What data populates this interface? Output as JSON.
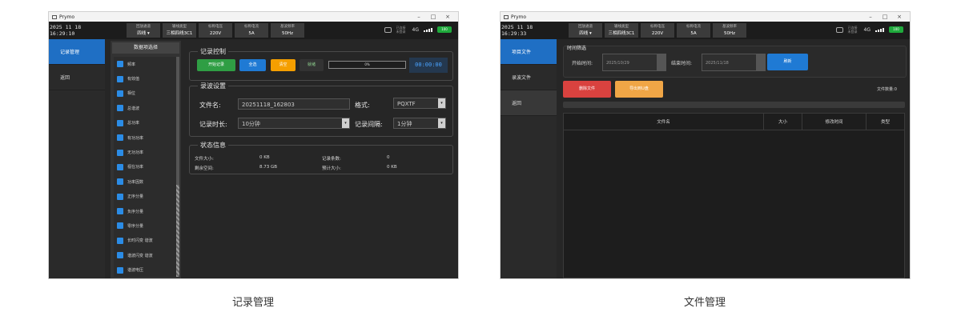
{
  "app_title": "Prymo",
  "window_controls": [
    "–",
    "□",
    "×"
  ],
  "status": {
    "net_label": "已连接 未登录",
    "signal": "4G",
    "battery": "100"
  },
  "header_info": [
    {
      "label": "回放通道",
      "value": "四线 ▾"
    },
    {
      "label": "输线类型",
      "value": "三相四线3C1"
    },
    {
      "label": "标称电压",
      "value": "220V"
    },
    {
      "label": "标称电流",
      "value": "5A"
    },
    {
      "label": "基波频率",
      "value": "50Hz"
    }
  ],
  "left": {
    "clock": "2025 11 18 16:29:10",
    "nav": [
      {
        "label": "记录管理",
        "active": true
      },
      {
        "label": "返回",
        "active": false
      }
    ],
    "channel_panel": {
      "title": "数据项选择",
      "items": [
        "频率",
        "有效值",
        "相位",
        "总谐波",
        "总功率",
        "有功功率",
        "无功功率",
        "视在功率",
        "功率因数",
        "正序分量",
        "负序分量",
        "零序分量",
        "长时闪变 谐波",
        "谐波闪变 谐波",
        "谐波电压"
      ]
    },
    "record_control": {
      "title": "记录控制",
      "start": "开始记录",
      "all": "全选",
      "none": "清空",
      "state": "就绪",
      "progress_text": "0%",
      "progress": 0,
      "timer": "00:00:00"
    },
    "wave_settings": {
      "title": "录波设置",
      "filename_label": "文件名:",
      "filename": "20251118_162803",
      "format_label": "格式:",
      "format": "PQXTF",
      "duration_label": "记录时长:",
      "duration": "10分钟",
      "interval_label": "记录间隔:",
      "interval": "1分钟"
    },
    "status_info": {
      "title": "状态信息",
      "file_size_label": "文件大小:",
      "file_size": "0 KB",
      "records_label": "记录条数:",
      "records": "0",
      "free_label": "剩余空间:",
      "free": "8.73 GB",
      "estimate_label": "预计大小:",
      "estimate": "0 KB"
    },
    "caption": "记录管理"
  },
  "right": {
    "clock": "2025 11 18 16:29:33",
    "nav": [
      {
        "label": "项目文件",
        "active": true
      },
      {
        "label": "录波文件",
        "active": false
      },
      {
        "label": "返回",
        "active": false
      }
    ],
    "filter": {
      "title": "时间筛选",
      "start_label": "开始时间:",
      "start": "2025/10/29",
      "end_label": "结束时间:",
      "end": "2025/11/18",
      "search": "刷新"
    },
    "delete": "删除文件",
    "export": "导出到U盘",
    "count_label": "文件数量:",
    "count": "0",
    "table_headers": [
      "文件名",
      "大小",
      "修改时间",
      "类型"
    ],
    "caption": "文件管理"
  },
  "colors": {
    "accent_blue": "#1f6fc4",
    "green": "#2f9e44",
    "orange": "#f59f00",
    "red": "#d9423f",
    "light_orange": "#f0a646"
  }
}
